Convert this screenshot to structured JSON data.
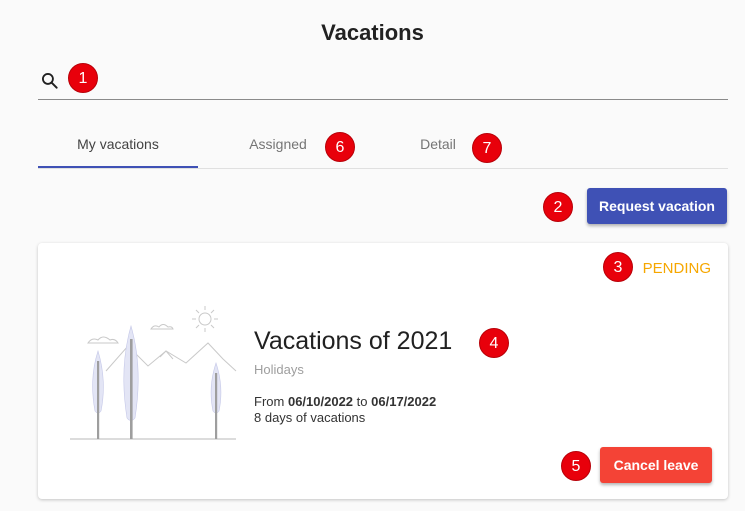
{
  "page": {
    "title": "Vacations"
  },
  "search": {
    "placeholder": ""
  },
  "tabs": [
    {
      "label": "My vacations",
      "active": true
    },
    {
      "label": "Assigned",
      "active": false
    },
    {
      "label": "Detail",
      "active": false
    }
  ],
  "actions": {
    "request_label": "Request vacation",
    "cancel_label": "Cancel leave"
  },
  "card": {
    "status": "PENDING",
    "title": "Vacations of 2021",
    "subtitle": "Holidays",
    "from_prefix": "From",
    "from_date": "06/10/2022",
    "to_word": "to",
    "to_date": "06/17/2022",
    "days_text": "8 days of vacations"
  },
  "badges": [
    "1",
    "2",
    "3",
    "4",
    "5",
    "6",
    "7"
  ],
  "colors": {
    "primary": "#3f51b5",
    "danger": "#f44336",
    "pending": "#f6a700",
    "badge": "#e8000b"
  },
  "icons": {
    "search": "search-icon",
    "illustration": "winter-trees-illustration"
  }
}
